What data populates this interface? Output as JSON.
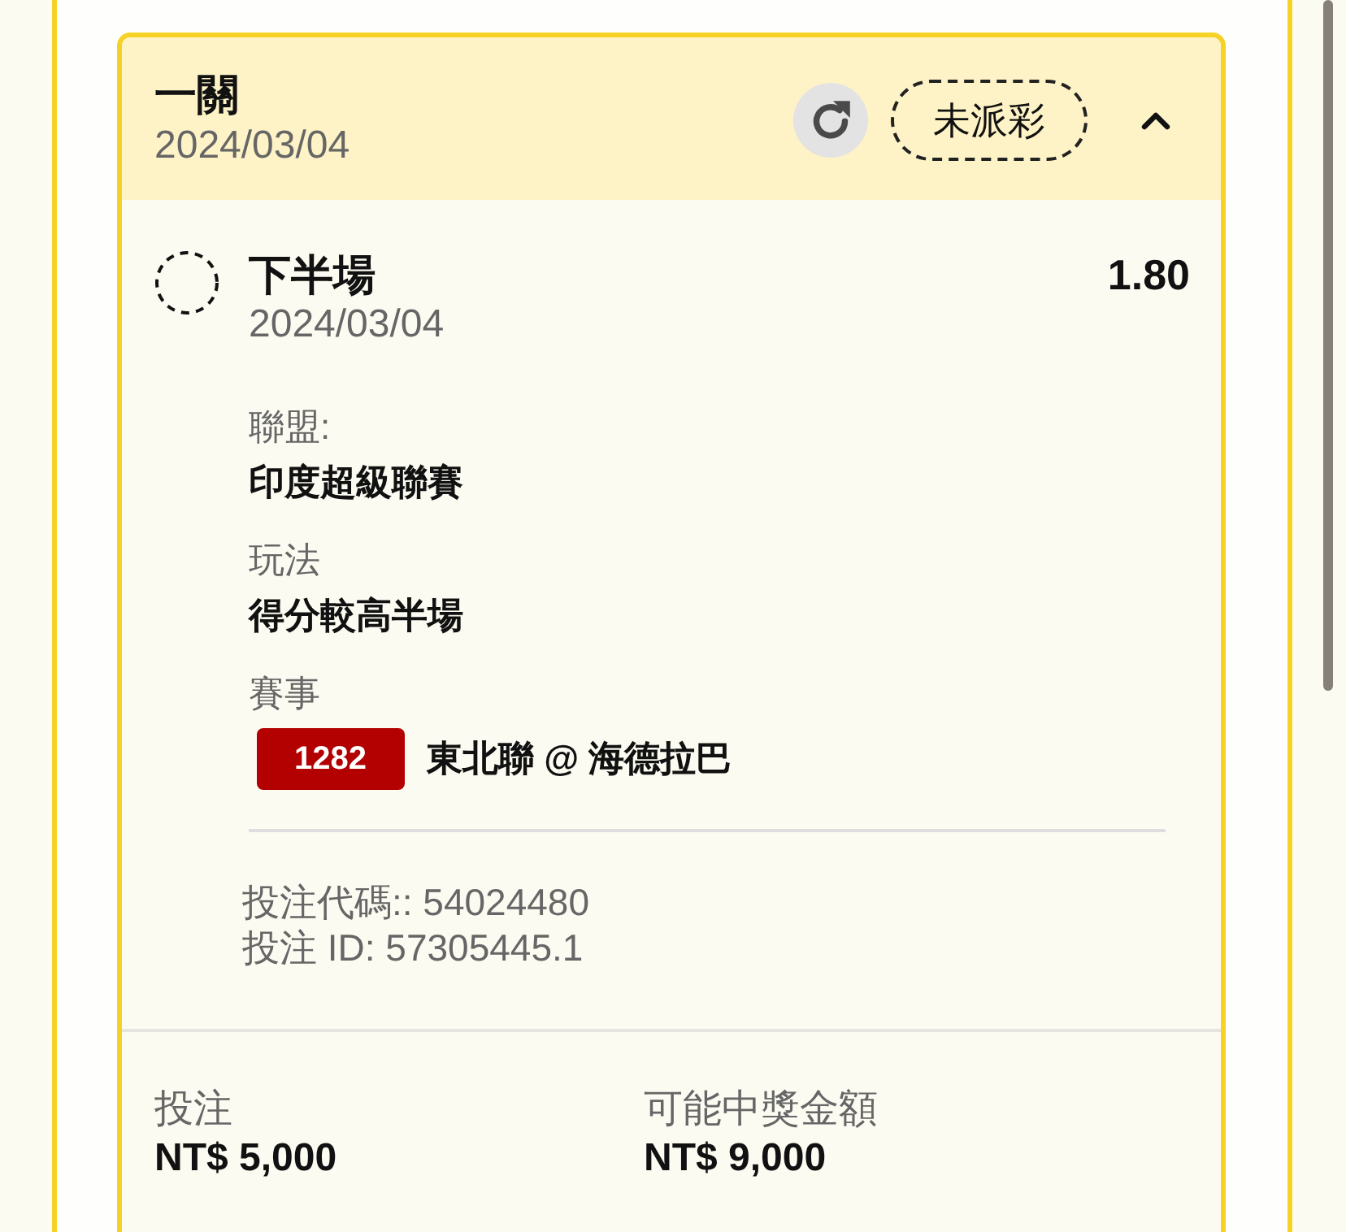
{
  "bet_card": {
    "title": "一關",
    "date": "2024/03/04",
    "status": "未派彩",
    "expanded": true
  },
  "selections": [
    {
      "selected": false,
      "name": "下半場",
      "date": "2024/03/04",
      "odds": "1.80",
      "details": [
        {
          "kind": "text",
          "label": "聯盟:",
          "value": "印度超級聯賽"
        },
        {
          "kind": "text",
          "label": "玩法",
          "value": "得分較高半場"
        },
        {
          "kind": "match",
          "label": "賽事",
          "match_code": "1282",
          "value": "東北聯 @ 海德拉巴"
        }
      ],
      "references": [
        "投注代碼:: 54024480",
        "投注 ID: 57305445.1"
      ]
    }
  ],
  "summary": [
    {
      "label": "投注",
      "value": "NT$ 5,000"
    },
    {
      "label": "可能中獎金額",
      "value": "NT$ 9,000"
    }
  ]
}
